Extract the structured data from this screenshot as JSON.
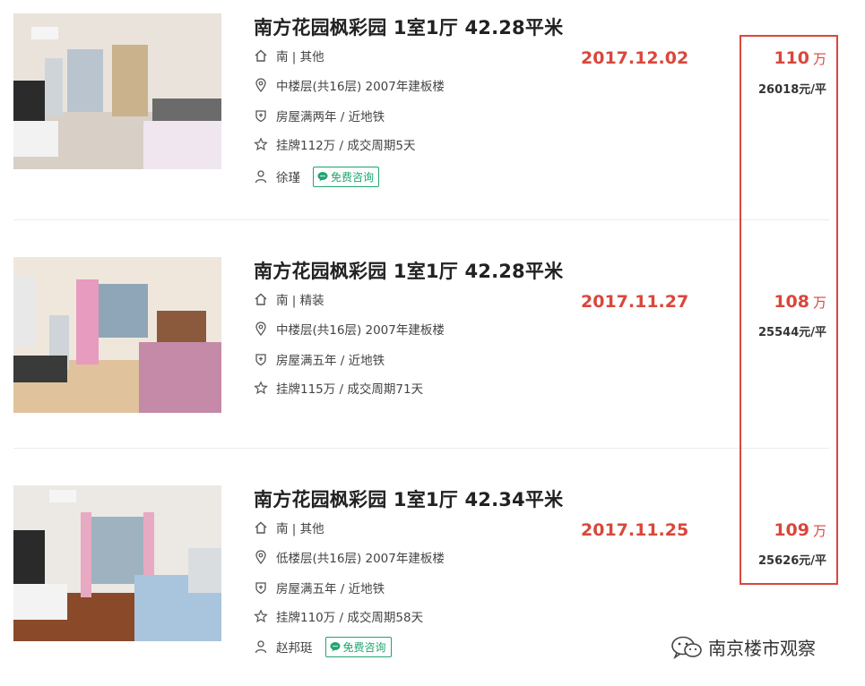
{
  "listings": [
    {
      "title": "南方花园枫彩园 1室1厅 42.28平米",
      "orientation": "南 | 其他",
      "floor": "中楼层(共16层) 2007年建板楼",
      "tags": "房屋满两年 / 近地铁",
      "listing": "挂牌112万 / 成交周期5天",
      "agent": "徐瑾",
      "consult": "免费咨询",
      "date": "2017.12.02",
      "price": "110",
      "price_unit": "万",
      "unit_price": "26018元/平"
    },
    {
      "title": "南方花园枫彩园 1室1厅 42.28平米",
      "orientation": "南 | 精装",
      "floor": "中楼层(共16层) 2007年建板楼",
      "tags": "房屋满五年 / 近地铁",
      "listing": "挂牌115万 / 成交周期71天",
      "date": "2017.11.27",
      "price": "108",
      "price_unit": "万",
      "unit_price": "25544元/平"
    },
    {
      "title": "南方花园枫彩园 1室1厅 42.34平米",
      "orientation": "南 | 其他",
      "floor": "低楼层(共16层) 2007年建板楼",
      "tags": "房屋满五年 / 近地铁",
      "listing": "挂牌110万 / 成交周期58天",
      "agent": "赵邦珽",
      "consult": "免费咨询",
      "date": "2017.11.25",
      "price": "109",
      "price_unit": "万",
      "unit_price": "25626元/平"
    }
  ],
  "watermark": "南京楼市观察",
  "colors": {
    "accent": "#d9473a",
    "consult": "#1fa56e",
    "text": "#333333"
  },
  "icons": [
    "house-icon",
    "location-pin-icon",
    "shield-icon",
    "star-icon",
    "person-icon",
    "chat-bubble-icon",
    "wechat-icon"
  ]
}
